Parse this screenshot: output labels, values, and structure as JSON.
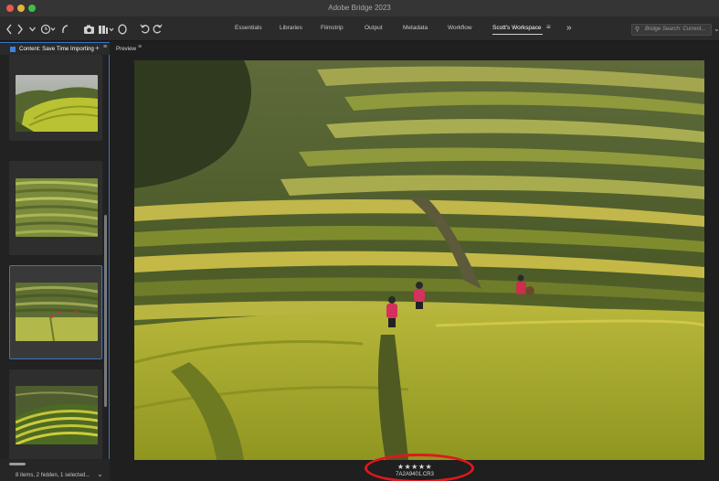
{
  "window": {
    "title": "Adobe Bridge 2023"
  },
  "toolbar": {
    "workspaces": [
      "Essentials",
      "Libraries",
      "Filmstrip",
      "Output",
      "Metadata",
      "Workflow",
      "Scott's Workspace"
    ],
    "active_workspace": "Scott's Workspace",
    "overflow_icon": "chevron-double-right-icon",
    "search_placeholder": "Bridge Search: Current..."
  },
  "content_panel": {
    "title": "Content: Save Time Importing",
    "status": "8 items, 2 hidden, 1 selected...",
    "thumbnails": [
      {
        "name": "terraced-hill-thumb",
        "selected": false
      },
      {
        "name": "terraces-curves-thumb",
        "selected": false
      },
      {
        "name": "terraces-people-thumb",
        "selected": true
      },
      {
        "name": "terraces-sunset-thumb",
        "selected": false
      }
    ]
  },
  "preview_panel": {
    "title": "Preview",
    "rating": "★★★★★",
    "filename": "7A2A9401.CR3"
  },
  "colors": {
    "accent": "#3a74c8",
    "highlight_circle": "#e0181b",
    "panel_bg": "#1f1f1f"
  }
}
